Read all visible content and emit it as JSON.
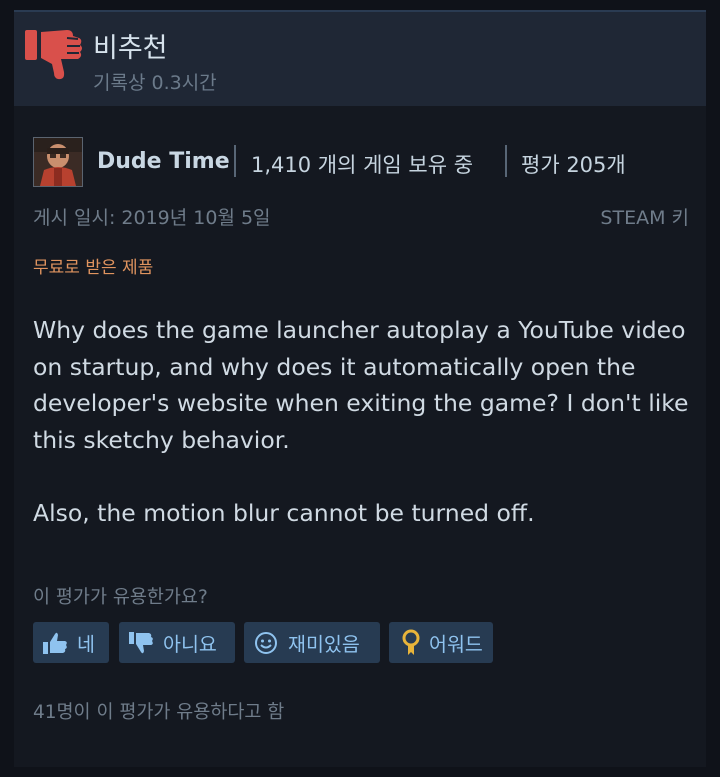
{
  "verdict": {
    "title": "비추천",
    "hours": "기록상 0.3시간",
    "icon": "thumb-down-icon"
  },
  "author": {
    "name": "Dude Time",
    "games": "1,410 개의 게임 보유 중",
    "reviews": "평가 205개"
  },
  "meta": {
    "posted": "게시 일시: 2019년 10월 5일",
    "key_source": "STEAM 키",
    "free_tag": "무료로 받은 제품"
  },
  "review": {
    "paragraph1": "Why does the game launcher autoplay a YouTube video on startup, and why does it automatically open the developer's website when exiting the game? I don't like this sketchy behavior.",
    "paragraph2": "Also, the motion blur cannot be turned off."
  },
  "feedback": {
    "question": "이 평가가 유용한가요?",
    "yes_label": "네",
    "no_label": "아니요",
    "funny_label": "재미있음",
    "award_label": "어워드",
    "helpful_count": "41명이 이 평가가 유용하다고 함"
  },
  "colors": {
    "verdict_thumb": "#d9504b",
    "button_bg": "#273b52",
    "button_text": "#8fc3ef",
    "free_tag": "#e0945f",
    "award": "#e8b43a"
  }
}
